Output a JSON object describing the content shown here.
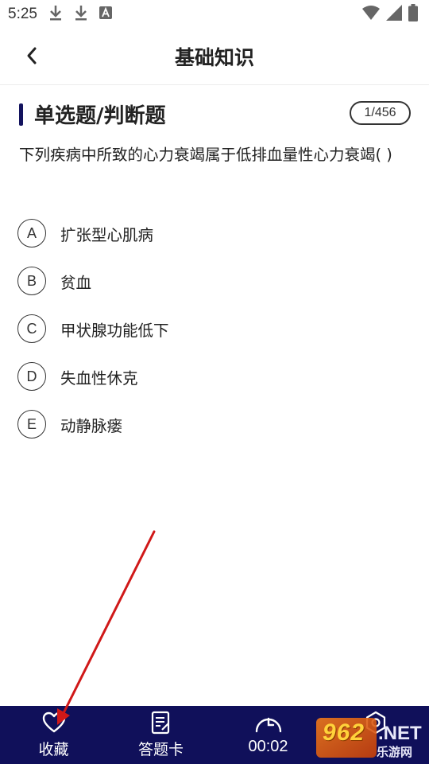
{
  "status_bar": {
    "time": "5:25",
    "left_icons": [
      "download-icon",
      "download-icon",
      "a-badge-icon"
    ],
    "right_icons": [
      "wifi-icon",
      "signal-icon",
      "battery-icon"
    ]
  },
  "header": {
    "title": "基础知识",
    "back_icon": "chevron-left-icon"
  },
  "section": {
    "title": "单选题/判断题",
    "counter": "1/456"
  },
  "question": {
    "text": "下列疾病中所致的心力衰竭属于低排血量性心力衰竭( )"
  },
  "options": [
    {
      "key": "A",
      "text": "扩张型心肌病"
    },
    {
      "key": "B",
      "text": "贫血"
    },
    {
      "key": "C",
      "text": "甲状腺功能低下"
    },
    {
      "key": "D",
      "text": "失血性休克"
    },
    {
      "key": "E",
      "text": "动静脉瘘"
    }
  ],
  "bottom_nav": {
    "favorite": {
      "label": "收藏",
      "icon": "heart-icon"
    },
    "answer_card": {
      "label": "答题卡",
      "icon": "card-icon"
    },
    "timer": {
      "label": "00:02",
      "icon": "clock-icon"
    },
    "settings": {
      "icon": "gear-icon"
    }
  },
  "watermark": {
    "number": "962",
    "net": ".NET",
    "subtitle": "乐游网"
  },
  "colors": {
    "accent": "#10105a",
    "annotation_arrow": "#d01818"
  }
}
